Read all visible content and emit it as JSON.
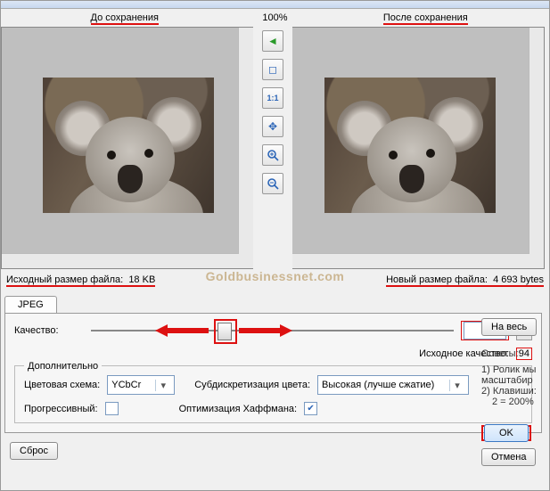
{
  "header": {
    "before_label": "До сохранения",
    "after_label": "После сохранения",
    "zoom": "100%"
  },
  "tools": {
    "arrow_left": "arrow-left-icon",
    "fit": "fit-window-icon",
    "one_to_one": "1:1",
    "center": "center-icon",
    "zoom_in": "zoom-in-icon",
    "zoom_out": "zoom-out-icon"
  },
  "sizes": {
    "orig_label": "Исходный размер файла:",
    "orig_value": "18 KB",
    "new_label": "Новый размер файла:",
    "new_value": "4 693 bytes",
    "watermark": "Goldbusinessnet.com"
  },
  "tabs": {
    "jpeg": "JPEG"
  },
  "quality": {
    "label": "Качество:",
    "value": "35",
    "orig_label": "Исходное качество:",
    "orig_value": "94"
  },
  "advanced": {
    "legend": "Дополнительно",
    "colorspace_label": "Цветовая схема:",
    "colorspace_value": "YCbCr",
    "subsampling_label": "Субдискретизация цвета:",
    "subsampling_value": "Высокая (лучше сжатие)",
    "progressive_label": "Прогрессивный:",
    "progressive_checked": false,
    "huffman_label": "Оптимизация Хаффмана:",
    "huffman_checked": true
  },
  "right": {
    "fullscreen": "На весь",
    "tips_header": "Советы:",
    "tip1": "1) Ролик мы",
    "tip1b": "масштабир",
    "tip2": "2) Клавиши:",
    "tip2b": "2 = 200%"
  },
  "buttons": {
    "ok": "OK",
    "cancel": "Отмена",
    "reset": "Сброс"
  }
}
